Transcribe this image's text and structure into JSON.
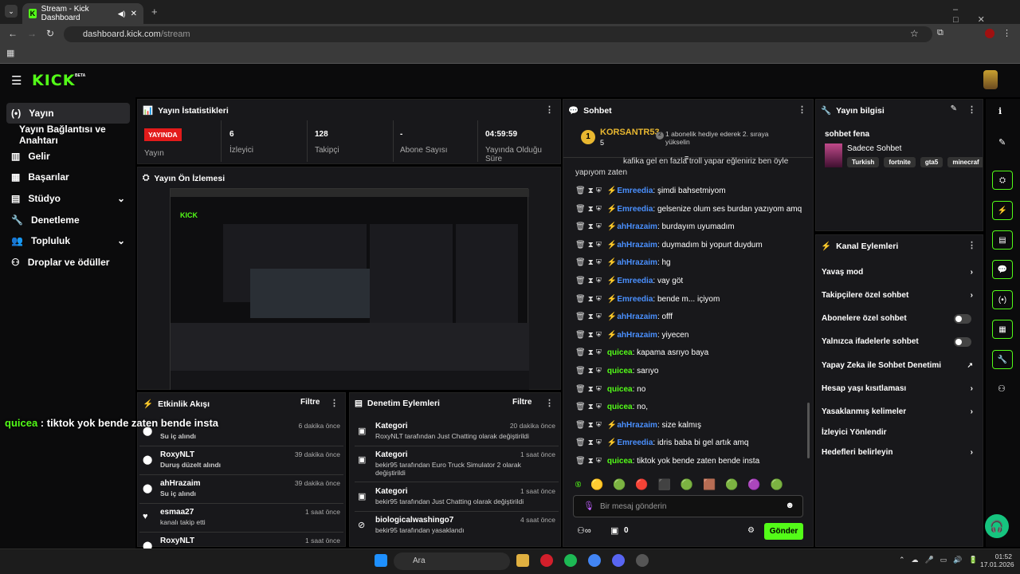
{
  "browser": {
    "tab_title": "Stream - Kick Dashboard",
    "url_host": "dashboard.kick.com",
    "url_path": "/stream"
  },
  "app": {
    "logo": "KICK",
    "beta": "BETA"
  },
  "sidebar": {
    "items": [
      {
        "label": "Yayın",
        "icon": "broadcast-icon"
      },
      {
        "label": "Yayın Bağlantısı ve Anahtarı"
      },
      {
        "label": "Gelir",
        "icon": "revenue-icon"
      },
      {
        "label": "Başarılar",
        "icon": "achievements-icon"
      },
      {
        "label": "Stüdyo",
        "icon": "studio-icon"
      },
      {
        "label": "Denetleme",
        "icon": "wrench-icon"
      },
      {
        "label": "Topluluk",
        "icon": "community-icon"
      },
      {
        "label": "Droplar ve ödüller",
        "icon": "gift-icon"
      }
    ]
  },
  "stats": {
    "title": "Yayın İstatistikleri",
    "live_badge": "YAYINDA",
    "live_label": "Yayın",
    "viewers": "6",
    "viewers_label": "İzleyici",
    "followers": "128",
    "followers_label": "Takipçi",
    "subs": "-",
    "subs_label": "Abone Sayısı",
    "uptime": "04:59:59",
    "uptime_label": "Yayında Olduğu Süre"
  },
  "preview": {
    "title": "Yayın Ön İzlemesi"
  },
  "overlay_text": {
    "name": "quicea",
    "message": " : tiktok yok bende zaten bende insta"
  },
  "activity": {
    "title": "Etkinlik Akışı",
    "filter": "Filtre",
    "rows": [
      {
        "name": "",
        "sub": "Su iç alındı",
        "time": "6 dakika önce"
      },
      {
        "name": "RoxyNLT",
        "sub": "Duruş düzelt alındı",
        "time": "39 dakika önce"
      },
      {
        "name": "ahHrazaim",
        "sub": "Su iç alındı",
        "time": "39 dakika önce"
      },
      {
        "name": "esmaa27",
        "sub": "kanalı takip etti",
        "time": "1 saat önce"
      },
      {
        "name": "RoxyNLT",
        "sub": "",
        "time": "1 saat önce"
      }
    ]
  },
  "mod": {
    "title": "Denetim Eylemleri",
    "filter": "Filtre",
    "rows": [
      {
        "name": "Kategori",
        "sub": "RoxyNLT tarafından Just Chatting olarak değiştirildi",
        "time": "20 dakika önce"
      },
      {
        "name": "Kategori",
        "sub": "bekir95 tarafından Euro Truck Simulator 2 olarak değiştirildi",
        "time": "1 saat önce"
      },
      {
        "name": "Kategori",
        "sub": "bekir95 tarafından Just Chatting olarak değiştirildi",
        "time": "1 saat önce"
      },
      {
        "name": "biologicalwashingo7",
        "sub": "bekir95 tarafından yasaklandı",
        "time": "4 saat önce"
      }
    ]
  },
  "chat": {
    "title": "Sohbet",
    "top_user": "KORSANTR53",
    "top_rank": "1",
    "top_count": "5",
    "gift_text": "1 abonelik hediye ederek 2. sıraya yükselin",
    "partial_line": "kafika gel en fazla troll yapar eğleniriz ben öyle yapıyom zaten",
    "lines": [
      {
        "u": "Emreedia",
        "c": "#4a90ff",
        "m": ": şimdi bahsetmiyom"
      },
      {
        "u": "Emreedia",
        "c": "#4a90ff",
        "m": ": gelsenize olum ses burdan yazıyom amq"
      },
      {
        "u": "ahHrazaim",
        "c": "#4a90ff",
        "m": ": burdayım uyumadım"
      },
      {
        "u": "ahHrazaim",
        "c": "#4a90ff",
        "m": ": duymadım bi yopurt duydum"
      },
      {
        "u": "ahHrazaim",
        "c": "#4a90ff",
        "m": ": hg"
      },
      {
        "u": "Emreedia",
        "c": "#4a90ff",
        "m": ": vay göt"
      },
      {
        "u": "Emreedia",
        "c": "#4a90ff",
        "m": ": bende m... içiyom"
      },
      {
        "u": "ahHrazaim",
        "c": "#4a90ff",
        "m": ": offf"
      },
      {
        "u": "ahHrazaim",
        "c": "#4a90ff",
        "m": ": yiyecen"
      },
      {
        "u": "quicea",
        "c": "#53fc18",
        "m": ": kapama asrıyo baya"
      },
      {
        "u": "quicea",
        "c": "#53fc18",
        "m": ": sarıyo"
      },
      {
        "u": "quicea",
        "c": "#53fc18",
        "m": ": no"
      },
      {
        "u": "quicea",
        "c": "#53fc18",
        "m": ": no,"
      },
      {
        "u": "ahHrazaim",
        "c": "#4a90ff",
        "m": ": size kalmış"
      },
      {
        "u": "Emreedia",
        "c": "#4a90ff",
        "m": ": idris baba bi gel artık amq"
      },
      {
        "u": "quicea",
        "c": "#53fc18",
        "m": ": tiktok yok bende zaten bende insta"
      }
    ],
    "input_placeholder": "Bir mesaj gönderin",
    "points": "0",
    "send": "Gönder"
  },
  "info": {
    "title": "Yayın bilgisi",
    "stream_title": "sohbet fena",
    "category": "Sadece Sohbet",
    "tags": [
      "Turkish",
      "fortnite",
      "gta5",
      "minecraf"
    ]
  },
  "actions": {
    "title": "Kanal Eylemleri",
    "items": [
      {
        "label": "Yavaş mod",
        "kind": "chev"
      },
      {
        "label": "Takipçilere özel sohbet",
        "kind": "chev"
      },
      {
        "label": "Abonelere özel sohbet",
        "kind": "toggle"
      },
      {
        "label": "Yalnızca ifadelerle sohbet",
        "kind": "toggle"
      },
      {
        "label": "Yapay Zeka ile Sohbet Denetimi",
        "kind": "ext"
      },
      {
        "label": "Hesap yaşı kısıtlaması",
        "kind": "chev"
      },
      {
        "label": "Yasaklanmış kelimeler",
        "kind": "chev"
      },
      {
        "label": "İzleyici Yönlendir",
        "kind": "none"
      },
      {
        "label": "Hedefleri belirleyin",
        "kind": "chev"
      }
    ]
  },
  "taskbar": {
    "search": "Ara",
    "time": "01:52",
    "date": "17.01.2026"
  }
}
